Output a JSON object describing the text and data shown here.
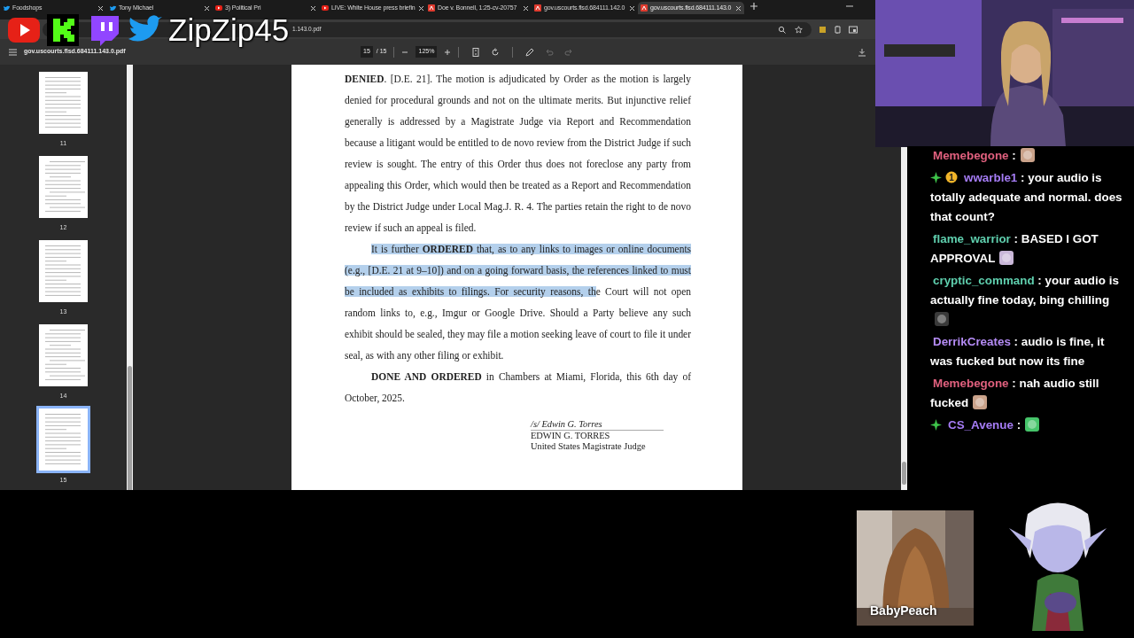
{
  "overlay": {
    "channel_name": "ZipZip45",
    "logos": [
      {
        "kind": "play"
      },
      {
        "kind": "k"
      },
      {
        "kind": "chat"
      },
      {
        "kind": "bird"
      }
    ]
  },
  "browser": {
    "tabs": [
      {
        "title": "Foodshops",
        "kind": "bird",
        "selected": false
      },
      {
        "title": "Tony Michael",
        "kind": "bird",
        "selected": false
      },
      {
        "title": "3) Political Pri",
        "kind": "play",
        "selected": false
      },
      {
        "title": "LIVE: White House press briefin",
        "kind": "play",
        "selected": false
      },
      {
        "title": "Doe v. Bonnell, 1:25-cv-20757",
        "kind": "pdf",
        "selected": false
      },
      {
        "title": "gov.uscourts.flsd.684111.142.0",
        "kind": "pdf",
        "selected": false
      },
      {
        "title": "gov.uscourts.flsd.684111.143.0",
        "kind": "pdf",
        "selected": true
      }
    ],
    "address": "1.143.0.pdf"
  },
  "pdf_toolbar": {
    "filename": "gov.uscourts.flsd.684111.143.0.pdf",
    "page": "15",
    "page_count": "/ 15",
    "zoom": "125%",
    "tools": [
      {
        "kind": "fit",
        "disabled": false
      },
      {
        "kind": "rotate",
        "disabled": false
      },
      {
        "kind": "annotate",
        "disabled": false
      },
      {
        "kind": "undo",
        "disabled": true
      },
      {
        "kind": "redo",
        "disabled": true
      }
    ]
  },
  "thumbnails": [
    {
      "label": "11",
      "selected": false
    },
    {
      "label": "12",
      "selected": false
    },
    {
      "label": "13",
      "selected": false
    },
    {
      "label": "14",
      "selected": false
    },
    {
      "label": "15",
      "selected": true
    }
  ],
  "document": {
    "paragraphs": [
      {
        "indent": false,
        "segments": [
          {
            "text": "**DENIED**.  [D.E. 21].  The motion is adjudicated by Order as the motion is largely denied for procedural grounds and not on the ultimate merits.  But injunctive relief generally is addressed by a Magistrate Judge via Report and Recommendation because a litigant would be entitled to de novo review from the District Judge if such review is sought.  The entry of this Order thus does not foreclose any party from appealing this Order, which would then be treated as a Report and Recommendation by the District Judge under Local Mag.J. R. 4.  The parties retain the right to de novo review if such an appeal is filed.",
            "highlighted": false
          }
        ]
      },
      {
        "indent": true,
        "segments": [
          {
            "text": "It is further **ORDERED** that, as to any links to images or online documents (e.g., [D.E. 21 at 9–10]) and on a going forward basis, the references linked to must be included as exhibits to filings.  For security reasons, th",
            "highlighted": true
          },
          {
            "text": "e Court will not open random links to, e.g., Imgur or Google Drive.  Should a Party believe any such exhibit should be sealed, they may file a motion seeking leave of court to file it under seal, as with any other filing or exhibit.",
            "highlighted": false
          }
        ]
      },
      {
        "indent": true,
        "segments": [
          {
            "text": "**DONE AND ORDERED** in Chambers at Miami, Florida, this 6th day of October, 2025.",
            "highlighted": false
          }
        ]
      }
    ],
    "signature": {
      "signed": "/s/ Edwin G. Torres",
      "name": "EDWIN G. TORRES",
      "title": "United States Magistrate Judge"
    }
  },
  "chat": [
    {
      "user": "Memebegone",
      "color": "#e0607e",
      "text": ":",
      "emote": true
    },
    {
      "badges": [
        {
          "kind": "diamond"
        },
        {
          "kind": "coin",
          "label": "1"
        }
      ],
      "user": "wwarble1",
      "color": "#a57cf5",
      "text": ": your audio is totally adequate and normal. does that count?"
    },
    {
      "user": "flame_warrior",
      "color": "#5fcfae",
      "text": ": BASED I GOT APPROVAL",
      "emote": true
    },
    {
      "user": "cryptic_command",
      "color": "#5fcfae",
      "text": ": your audio is actually fine today, bing chilling",
      "emote": true
    },
    {
      "user": "DerrikCreates",
      "color": "#b58cf5",
      "text": ": audio is fine, it was fucked but now its fine"
    },
    {
      "user": "Memebegone",
      "color": "#e0607e",
      "text": ": nah audio still fucked",
      "emote": true
    },
    {
      "badges": [
        {
          "kind": "diamond"
        }
      ],
      "user": "CS_Avenue",
      "color": "#a57cf5",
      "text": ":",
      "emote": true
    }
  ],
  "guest": {
    "caption": "BabyPeach"
  }
}
